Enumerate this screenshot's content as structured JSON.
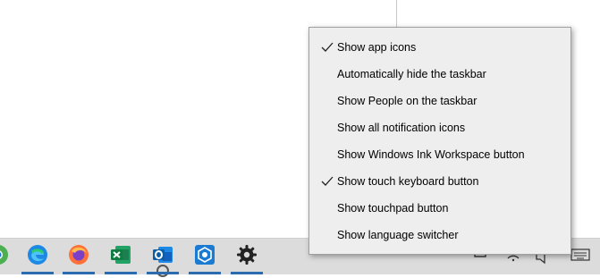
{
  "context_menu": {
    "items": [
      {
        "label": "Show app icons",
        "checked": true
      },
      {
        "label": "Automatically hide the taskbar",
        "checked": false
      },
      {
        "label": "Show People on the taskbar",
        "checked": false
      },
      {
        "label": "Show all notification icons",
        "checked": false
      },
      {
        "label": "Show Windows Ink Workspace button",
        "checked": false
      },
      {
        "label": "Show touch keyboard button",
        "checked": true
      },
      {
        "label": "Show touchpad button",
        "checked": false
      },
      {
        "label": "Show language switcher",
        "checked": false
      }
    ]
  },
  "taskbar": {
    "apps": [
      {
        "icon": "chrome-icon"
      },
      {
        "icon": "edge-icon"
      },
      {
        "icon": "firefox-icon"
      },
      {
        "icon": "excel-icon"
      },
      {
        "icon": "outlook-icon"
      },
      {
        "icon": "snip-tool-icon"
      },
      {
        "icon": "settings-gear-icon"
      }
    ],
    "tray": [
      "battery-icon",
      "wifi-icon",
      "volume-icon",
      "touch-keyboard-icon"
    ]
  },
  "colors": {
    "menu_bg": "#eeeeee",
    "taskbar_bg": "#dcdcdc",
    "active_underline": "#2b6cb0"
  }
}
